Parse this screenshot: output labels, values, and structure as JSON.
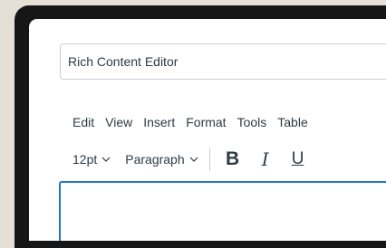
{
  "title_field": {
    "value": "Rich Content Editor"
  },
  "menubar": {
    "items": [
      "Edit",
      "View",
      "Insert",
      "Format",
      "Tools",
      "Table"
    ]
  },
  "toolbar": {
    "font_size": "12pt",
    "block_format": "Paragraph",
    "bold_label": "B",
    "italic_label": "I",
    "underline_label": "U",
    "chevron_icon": "chevron-down-icon"
  },
  "colors": {
    "background": "#e6dfd8",
    "device_frame": "#161616",
    "text": "#2d3b45",
    "border": "#c8cfd4",
    "focus_border": "#1f79c2"
  }
}
